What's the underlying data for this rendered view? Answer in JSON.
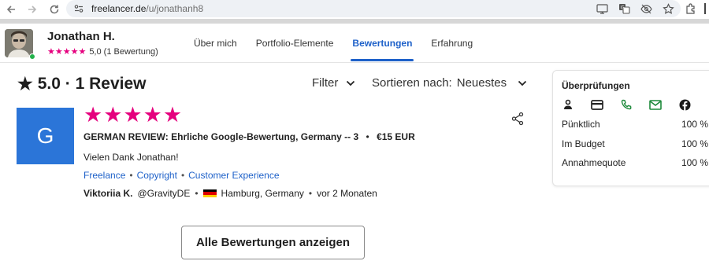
{
  "browser": {
    "url_host": "freelancer.de",
    "url_path": "/u/jonathanh8"
  },
  "profile": {
    "name": "Jonathan H.",
    "stars": "★★★★★",
    "rating_text": "5,0 (1 Bewertung)",
    "online": true
  },
  "tabs": [
    {
      "label": "Über mich",
      "active": false
    },
    {
      "label": "Portfolio-Elemente",
      "active": false
    },
    {
      "label": "Bewertungen",
      "active": true
    },
    {
      "label": "Erfahrung",
      "active": false
    }
  ],
  "reviews_header": {
    "star": "★",
    "title": "5.0 · 1 Review",
    "filter_label": "Filter",
    "sort_label": "Sortieren nach:",
    "sort_value": "Neuestes"
  },
  "review": {
    "logo_letter": "G",
    "logo_color": "#2b75d8",
    "stars": "★★★★★",
    "star_color": "#e5007e",
    "title": "GERMAN REVIEW: Ehrliche Google-Bewertung, Germany -- 3",
    "price": "€15 EUR",
    "text": "Vielen Dank Jonathan!",
    "tags": [
      "Freelance",
      "Copyright",
      "Customer Experience"
    ],
    "author_name": "Viktoriia K.",
    "author_handle": "@GravityDE",
    "location": "Hamburg, Germany",
    "time": "vor 2 Monaten"
  },
  "all_reviews_button": "Alle Bewertungen anzeigen",
  "verifications": {
    "title": "Überprüfungen",
    "icons": [
      "person-icon",
      "credit-card-icon",
      "phone-icon",
      "email-icon",
      "facebook-icon"
    ],
    "rows": [
      {
        "label": "Pünktlich",
        "value": "100 %"
      },
      {
        "label": "Im Budget",
        "value": "100 %"
      },
      {
        "label": "Annahmequote",
        "value": "100 %"
      }
    ]
  },
  "colors": {
    "accent": "#1e61c9",
    "star": "#e5007e",
    "verified_green": "#1e8a3c"
  }
}
